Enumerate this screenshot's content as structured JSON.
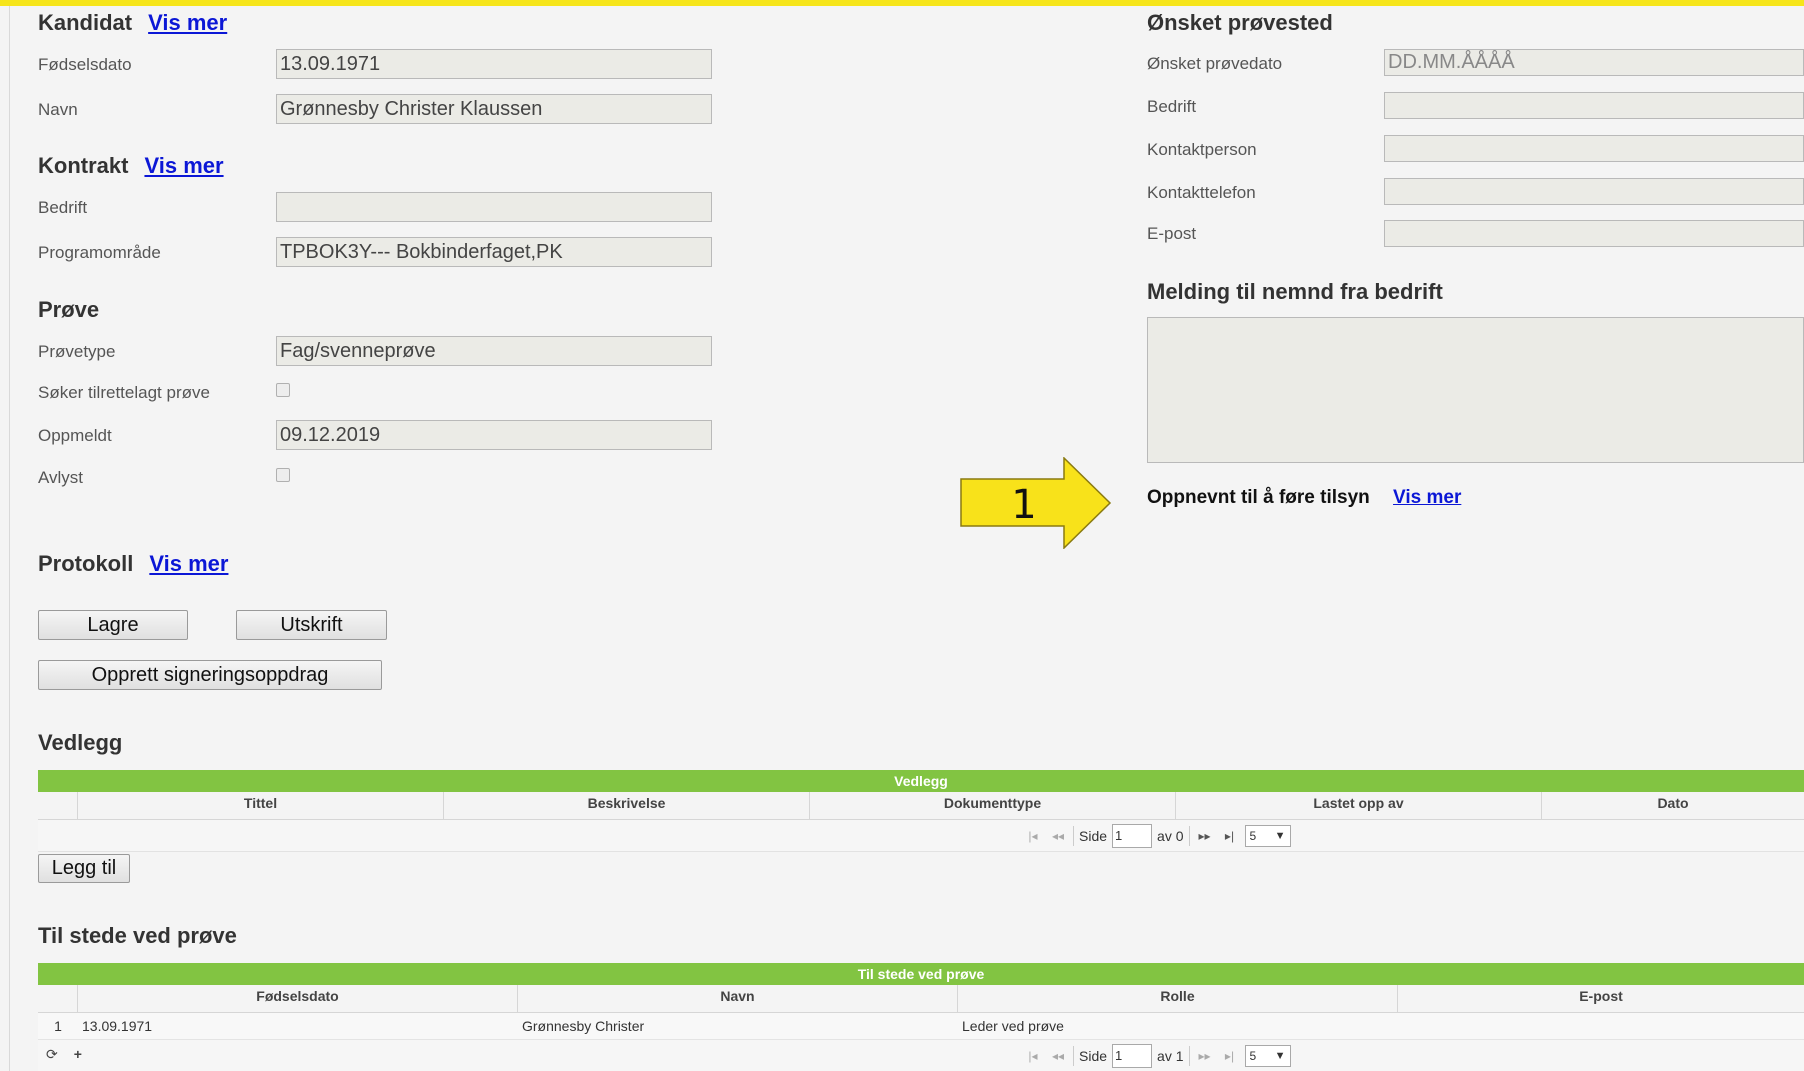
{
  "kandidat": {
    "title": "Kandidat",
    "vis_mer": "Vis mer",
    "fodselsdato_label": "Fødselsdato",
    "fodselsdato_value": "13.09.1971",
    "navn_label": "Navn",
    "navn_value": "Grønnesby Christer Klaussen"
  },
  "kontrakt": {
    "title": "Kontrakt",
    "vis_mer": "Vis mer",
    "bedrift_label": "Bedrift",
    "bedrift_value": "",
    "programomrade_label": "Programområde",
    "programomrade_value": "TPBOK3Y--- Bokbinderfaget,PK"
  },
  "prove": {
    "title": "Prøve",
    "provetype_label": "Prøvetype",
    "provetype_value": "Fag/svenneprøve",
    "tilrettelagt_label": "Søker tilrettelagt prøve",
    "oppmeldt_label": "Oppmeldt",
    "oppmeldt_value": "09.12.2019",
    "avlyst_label": "Avlyst"
  },
  "protokoll": {
    "title": "Protokoll",
    "vis_mer": "Vis mer"
  },
  "buttons": {
    "lagre": "Lagre",
    "utskrift": "Utskrift",
    "signering": "Opprett signeringsoppdrag",
    "legg_til": "Legg til"
  },
  "onsket": {
    "title": "Ønsket prøvested",
    "dato_label": "Ønsket prøvedato",
    "dato_placeholder": "DD.MM.ÅÅÅÅ",
    "bedrift_label": "Bedrift",
    "kontaktperson_label": "Kontaktperson",
    "kontakttelefon_label": "Kontakttelefon",
    "epost_label": "E-post"
  },
  "melding": {
    "title": "Melding til nemnd fra bedrift"
  },
  "oppnevnt": {
    "label": "Oppnevnt til å føre tilsyn",
    "vis_mer": "Vis mer"
  },
  "callout": {
    "number": "1",
    "color": "#f8e21a"
  },
  "vedlegg": {
    "title": "Vedlegg",
    "caption": "Vedlegg",
    "columns": [
      "Tittel",
      "Beskrivelse",
      "Dokumenttype",
      "Lastet opp av",
      "Dato"
    ],
    "pager": {
      "side": "Side",
      "page": "1",
      "av": "av 0",
      "size": "5"
    }
  },
  "tilstede": {
    "title": "Til stede ved prøve",
    "caption": "Til stede ved prøve",
    "columns": [
      "Fødselsdato",
      "Navn",
      "Rolle",
      "E-post"
    ],
    "rows": [
      {
        "num": "1",
        "fodselsdato": "13.09.1971",
        "navn": "Grønnesby Christer",
        "rolle": "Leder ved prøve",
        "epost": ""
      }
    ],
    "pager": {
      "side": "Side",
      "page": "1",
      "av": "av 1",
      "size": "5"
    }
  },
  "colors": {
    "accent_bar": "#f6e51a",
    "grid_header": "#82c442",
    "link": "#0b17d6"
  }
}
